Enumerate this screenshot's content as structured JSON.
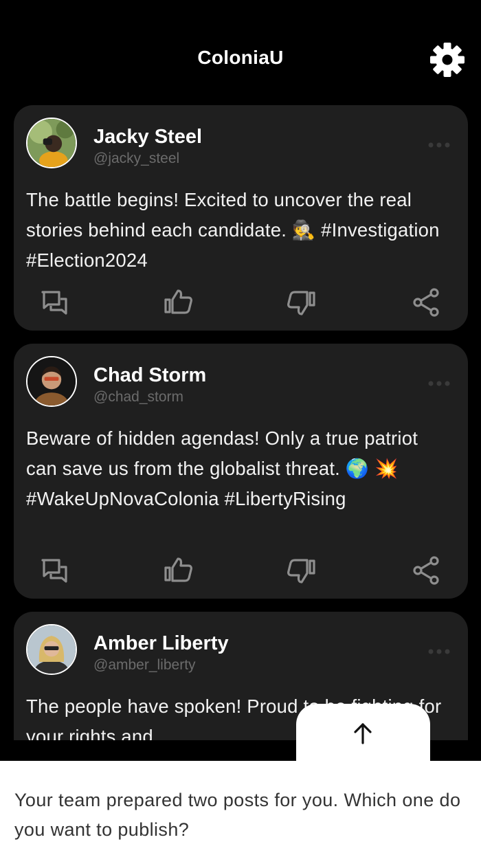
{
  "header": {
    "title": "ColoniaU",
    "settings_icon": "gear-icon"
  },
  "posts": [
    {
      "name": "Jacky Steel",
      "handle": "@jacky_steel",
      "text": "The battle begins! Excited to uncover the real stories behind each candidate. 🕵️ #Investigation #Election2024"
    },
    {
      "name": "Chad Storm",
      "handle": "@chad_storm",
      "text": "Beware of hidden agendas! Only a true patriot can save us from the globalist threat. 🌍 💥 #WakeUpNovaColonia #LibertyRising"
    },
    {
      "name": "Amber Liberty",
      "handle": "@amber_liberty",
      "text": "The people have spoken! Proud to be fighting for your rights and"
    }
  ],
  "actions": [
    "comment-icon",
    "thumbs-up-icon",
    "thumbs-down-icon",
    "share-icon"
  ],
  "prompt": "Your team prepared two posts for you. Which one do you want to publish?",
  "colors": {
    "background": "#000000",
    "card": "#1f1f1f",
    "handle": "#6b6b6b",
    "action_icon": "#8e8e8e"
  }
}
